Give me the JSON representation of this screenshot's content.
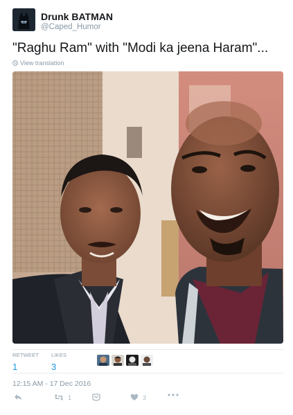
{
  "tweet": {
    "display_name": "Drunk BATMAN",
    "handle": "@Caped_Humor",
    "text": "\"Raghu Ram\" with \"Modi ka jeena Haram\"...",
    "translate_link": "View translation",
    "timestamp": "12:15 AM - 17 Dec 2016"
  },
  "stats": {
    "retweets_label": "RETWEET",
    "retweets_value": "1",
    "likes_label": "LIKES",
    "likes_value": "3"
  },
  "actions": {
    "retweet_count": "1",
    "like_count": "3"
  },
  "icons": [
    "globe-icon",
    "reply-icon",
    "retweet-icon",
    "dm-icon",
    "heart-icon",
    "more-icon"
  ],
  "colors": {
    "link": "#1b95e0",
    "muted": "#8899a6",
    "icon": "#aab8c2",
    "text": "#14171a",
    "divider": "#e6ecf0"
  }
}
